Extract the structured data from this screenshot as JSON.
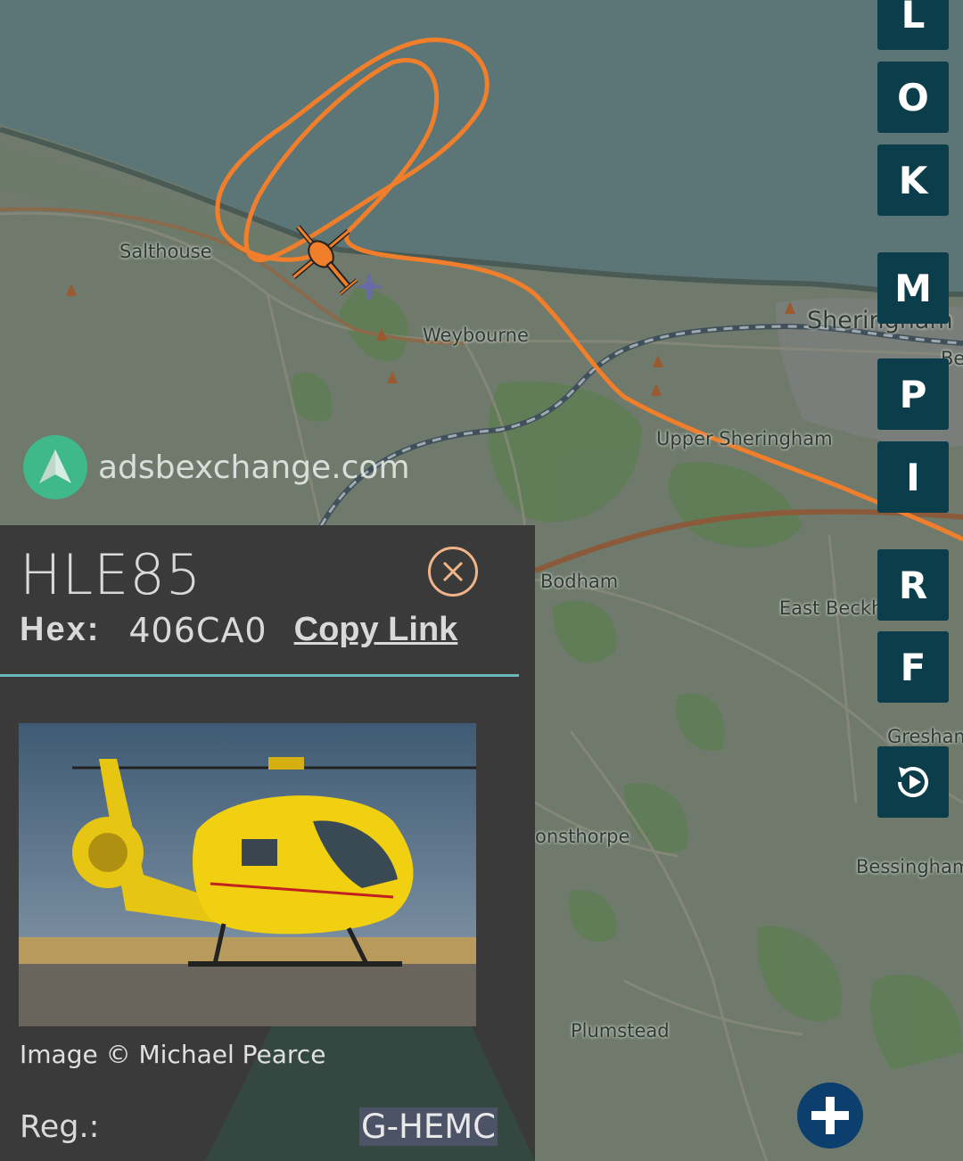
{
  "map": {
    "places": {
      "salthouse": "Salthouse",
      "weybourne": "Weybourne",
      "sheringham": "Sheringham",
      "upper_sheringham": "Upper Sheringham",
      "bodham": "Bodham",
      "east_beckham": "East Beckh",
      "gresham": "Gresham",
      "edgefield": "onsthorpe",
      "bessingham": "Bessingham",
      "plumstead": "Plumstead",
      "be": "Be"
    },
    "watermark": "adsbexchange.com",
    "colors": {
      "sea": "#5c7677",
      "land": "#6f7a6c",
      "track": "#f07e2a"
    }
  },
  "side_buttons": [
    {
      "label": "L"
    },
    {
      "label": "O"
    },
    {
      "label": "K"
    },
    {
      "label": "M"
    },
    {
      "label": "P"
    },
    {
      "label": "I"
    },
    {
      "label": "R"
    },
    {
      "label": "F"
    }
  ],
  "replay_icon": "replay-icon",
  "zoom_icon": "plus-icon",
  "panel": {
    "callsign": "HLE85",
    "hex_label": "Hex:",
    "hex_value": "406CA0",
    "copy_link": "Copy Link",
    "image_credit": "Image © Michael Pearce",
    "reg_label": "Reg.:",
    "reg_value": "G-HEMC",
    "close_icon": "close-circle-icon"
  }
}
